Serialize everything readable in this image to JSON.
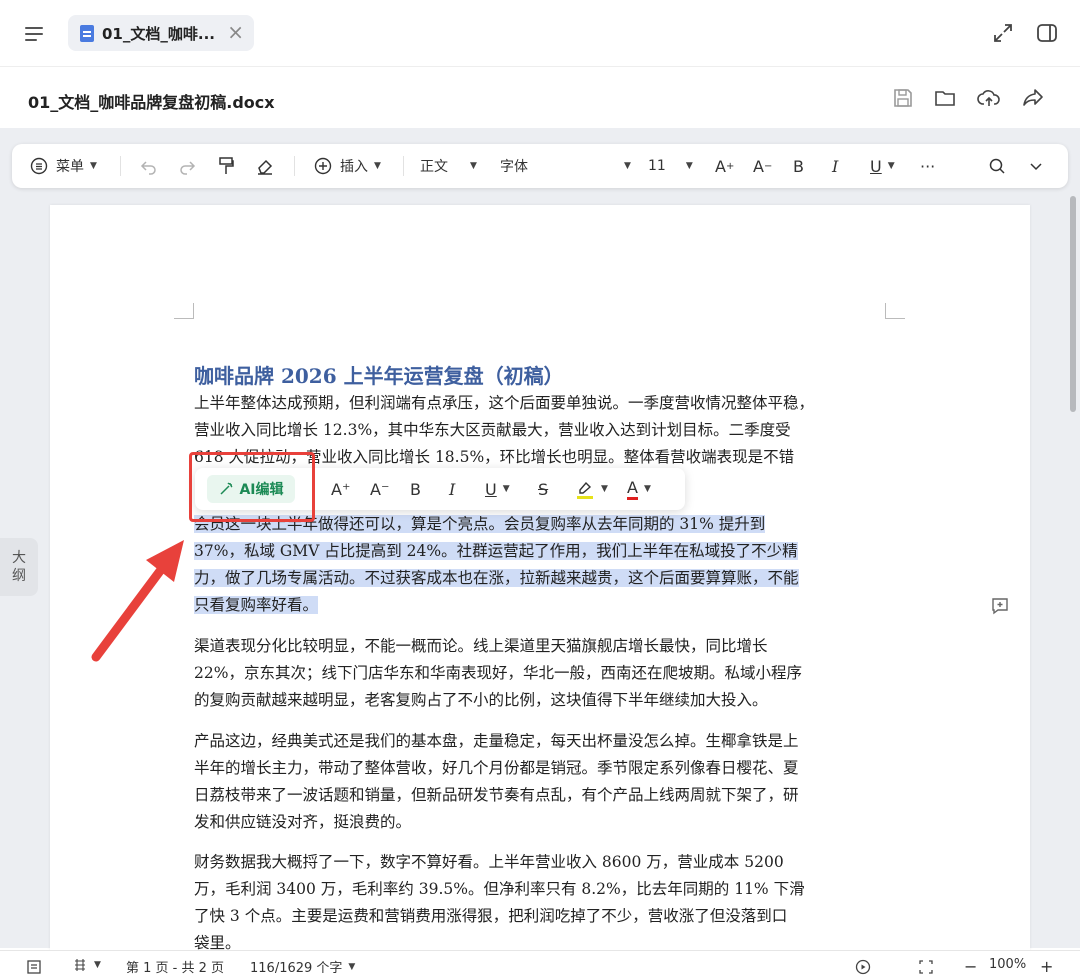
{
  "colors": {
    "accent": "#3e5f9f",
    "selection": "#cfdcf6",
    "annotation_red": "#e8413b",
    "ai_green": "#1c8a55"
  },
  "tab": {
    "label": "01_文档_咖啡...",
    "close": "×"
  },
  "file": {
    "name": "01_文档_咖啡品牌复盘初稿.docx"
  },
  "toolbar": {
    "menu": "菜单",
    "insert": "插入",
    "style": "正文",
    "font": "字体",
    "font_size": "11",
    "bold": "B",
    "italic": "I",
    "underline": "U",
    "more": "···"
  },
  "minibar": {
    "ai_edit": "AI编辑",
    "grow": "A⁺",
    "shrink": "A⁻",
    "bold": "B",
    "italic": "I",
    "underline": "U",
    "strike": "S",
    "color": "A"
  },
  "outline": {
    "line1": "大",
    "line2": "纲"
  },
  "document": {
    "title": "咖啡品牌 2026 上半年运营复盘（初稿）",
    "p1": [
      "上半年整体达成预期，但利润端有点承压，这个后面要单独说。一季度营收情况整体平稳，",
      "营业收入同比增长 12.3%，其中华东大区贡献最大，营业收入达到计划目标。二季度受",
      "618 大促拉动，营业收入同比增长 18.5%，环比增长也明显。整体看营收端表现是不错"
    ],
    "p2": [
      "会员这一块上半年做得还可以，算是个亮点。会员复购率从去年同期的 31% 提升到",
      "37%，私域 GMV 占比提高到 24%。社群运营起了作用，我们上半年在私域投了不少精",
      "力，做了几场专属活动。不过获客成本也在涨，拉新越来越贵，这个后面要算算账，不能",
      "只看复购率好看。"
    ],
    "p3": [
      "渠道表现分化比较明显，不能一概而论。线上渠道里天猫旗舰店增长最快，同比增长",
      "22%，京东其次；线下门店华东和华南表现好，华北一般，西南还在爬坡期。私域小程序",
      "的复购贡献越来越明显，老客复购占了不小的比例，这块值得下半年继续加大投入。"
    ],
    "p4": [
      "产品这边，经典美式还是我们的基本盘，走量稳定，每天出杯量没怎么掉。生椰拿铁是上",
      "半年的增长主力，带动了整体营收，好几个月份都是销冠。季节限定系列像春日樱花、夏",
      "日荔枝带来了一波话题和销量，但新品研发节奏有点乱，有个产品上线两周就下架了，研",
      "发和供应链没对齐，挺浪费的。"
    ],
    "p5": [
      "财务数据我大概捋了一下，数字不算好看。上半年营业收入 8600 万，营业成本 5200",
      "万，毛利润 3400 万，毛利率约 39.5%。但净利率只有 8.2%，比去年同期的 11% 下滑",
      "了快 3 个点。主要是运费和营销费用涨得狠，把利润吃掉了不少，营收涨了但没落到口",
      "袋里。"
    ]
  },
  "status": {
    "page_info": "第 1 页 - 共 2 页",
    "word_count": "116/1629 个字",
    "zoom": "100%",
    "zoom_out": "−",
    "zoom_in": "+"
  }
}
